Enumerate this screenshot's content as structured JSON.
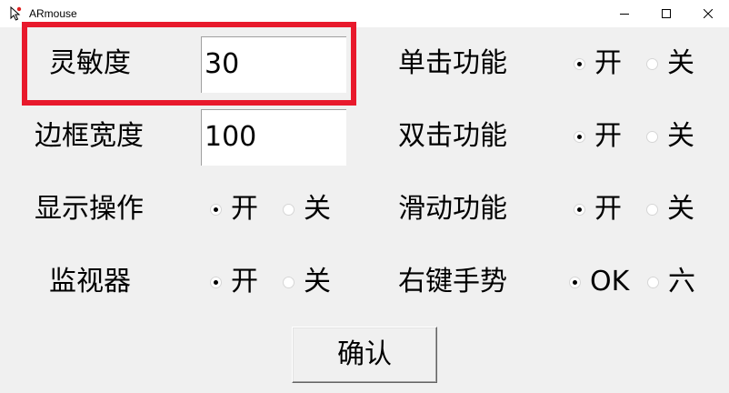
{
  "window": {
    "title": "ARmouse",
    "icon": "mouse-cursor-icon"
  },
  "settings": {
    "sensitivity": {
      "label": "灵敏度",
      "value": "30"
    },
    "border_width": {
      "label": "边框宽度",
      "value": "100"
    },
    "show_actions": {
      "label": "显示操作",
      "options": [
        "开",
        "关"
      ],
      "selected": "开"
    },
    "monitor": {
      "label": "监视器",
      "options": [
        "开",
        "关"
      ],
      "selected": "开"
    },
    "single_click": {
      "label": "单击功能",
      "options": [
        "开",
        "关"
      ],
      "selected": "开"
    },
    "double_click": {
      "label": "双击功能",
      "options": [
        "开",
        "关"
      ],
      "selected": "开"
    },
    "swipe": {
      "label": "滑动功能",
      "options": [
        "开",
        "关"
      ],
      "selected": "开"
    },
    "right_gesture": {
      "label": "右键手势",
      "options": [
        "OK",
        "六"
      ],
      "selected": "OK"
    }
  },
  "confirm_label": "确认",
  "colors": {
    "highlight": "#e8192c",
    "window_bg": "#f0f0f0",
    "titlebar_bg": "#ffffff"
  }
}
